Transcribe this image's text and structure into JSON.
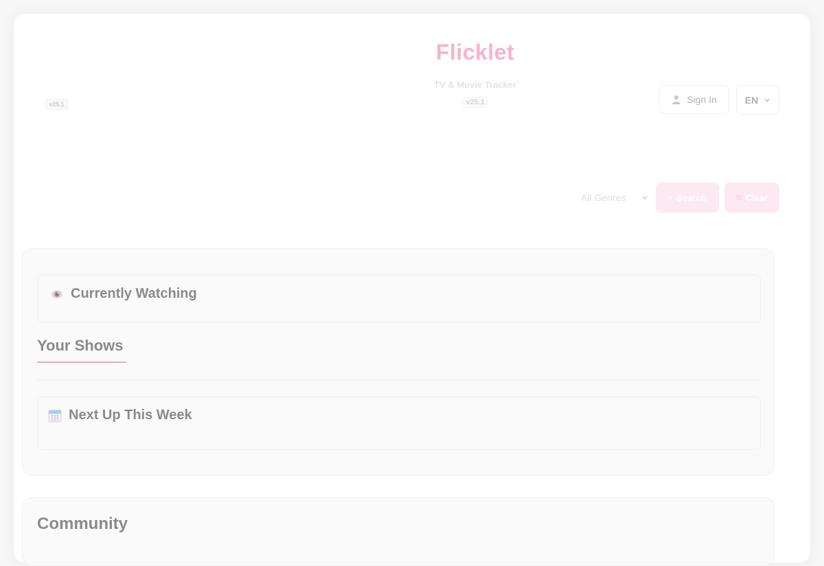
{
  "brand": {
    "title": "Flicklet",
    "subtitle": "TV & Movie Tracker",
    "version_left": "v25.1",
    "version_center": "v25.1"
  },
  "header": {
    "signin_label": "Sign In",
    "language": "EN"
  },
  "search": {
    "genre_selected": "All Genres",
    "search_label": "Search",
    "clear_label": "Clear"
  },
  "home": {
    "currently_watching": "Currently Watching",
    "your_shows": "Your Shows",
    "next_up": "Next Up This Week"
  },
  "community": {
    "title": "Community"
  },
  "icons": {
    "currently_watching": "eye-icon",
    "next_up": "calendar-icon",
    "signin": "user-icon"
  },
  "colors": {
    "brand_pink": "#f7b3ce",
    "button_pink": "#fde9f1",
    "underline_pink": "#f0a6c4"
  }
}
